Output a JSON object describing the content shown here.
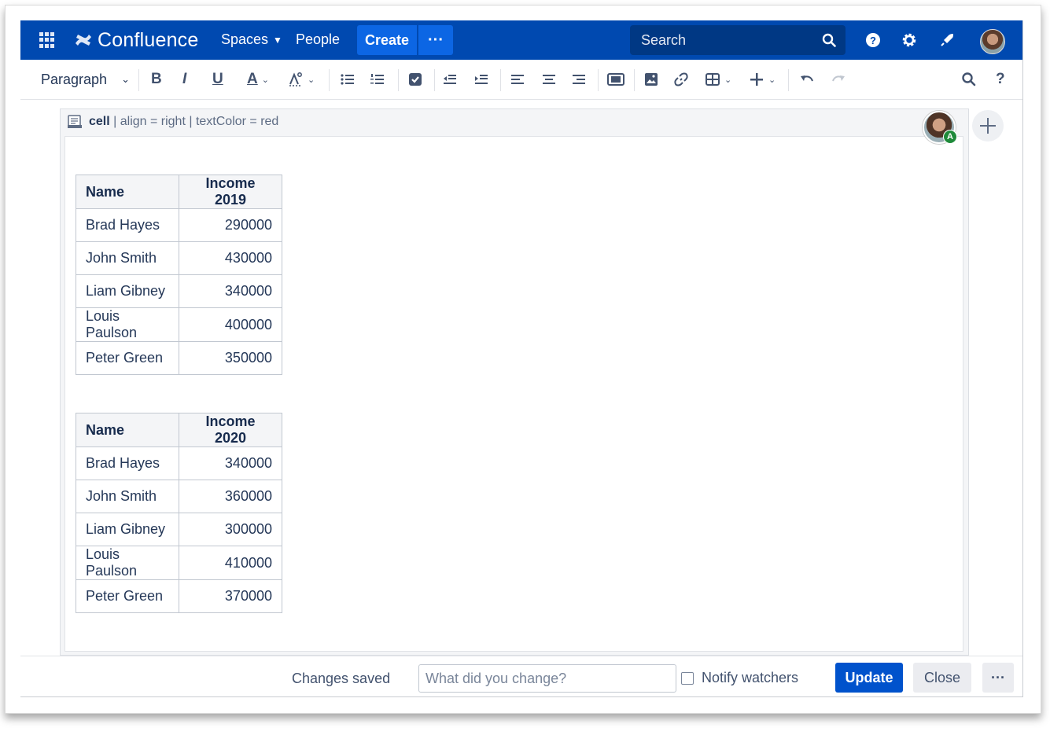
{
  "topbar": {
    "product_name": "Confluence",
    "nav": {
      "spaces": "Spaces",
      "people": "People"
    },
    "create_label": "Create",
    "more_label": "···",
    "search_placeholder": "Search",
    "brand_color": "#0049b0"
  },
  "toolbar": {
    "paragraph_label": "Paragraph",
    "bold": "B",
    "italic": "I",
    "underline": "U",
    "text_color": "A",
    "help": "?"
  },
  "macro": {
    "name": "cell",
    "params": " | align = right | textColor = red",
    "avatar_badge": "A"
  },
  "tables": [
    {
      "headers": [
        "Name",
        "Income 2019"
      ],
      "rows": [
        [
          "Brad Hayes",
          "290000"
        ],
        [
          "John Smith",
          "430000"
        ],
        [
          "Liam Gibney",
          "340000"
        ],
        [
          "Louis Paulson",
          "400000"
        ],
        [
          "Peter Green",
          "350000"
        ]
      ]
    },
    {
      "headers": [
        "Name",
        "Income 2020"
      ],
      "rows": [
        [
          "Brad Hayes",
          "340000"
        ],
        [
          "John Smith",
          "360000"
        ],
        [
          "Liam Gibney",
          "300000"
        ],
        [
          "Louis Paulson",
          "410000"
        ],
        [
          "Peter Green",
          "370000"
        ]
      ]
    }
  ],
  "footer": {
    "status": "Changes saved",
    "change_placeholder": "What did you change?",
    "notify_label": "Notify watchers",
    "update_label": "Update",
    "close_label": "Close",
    "more_label": "···"
  }
}
